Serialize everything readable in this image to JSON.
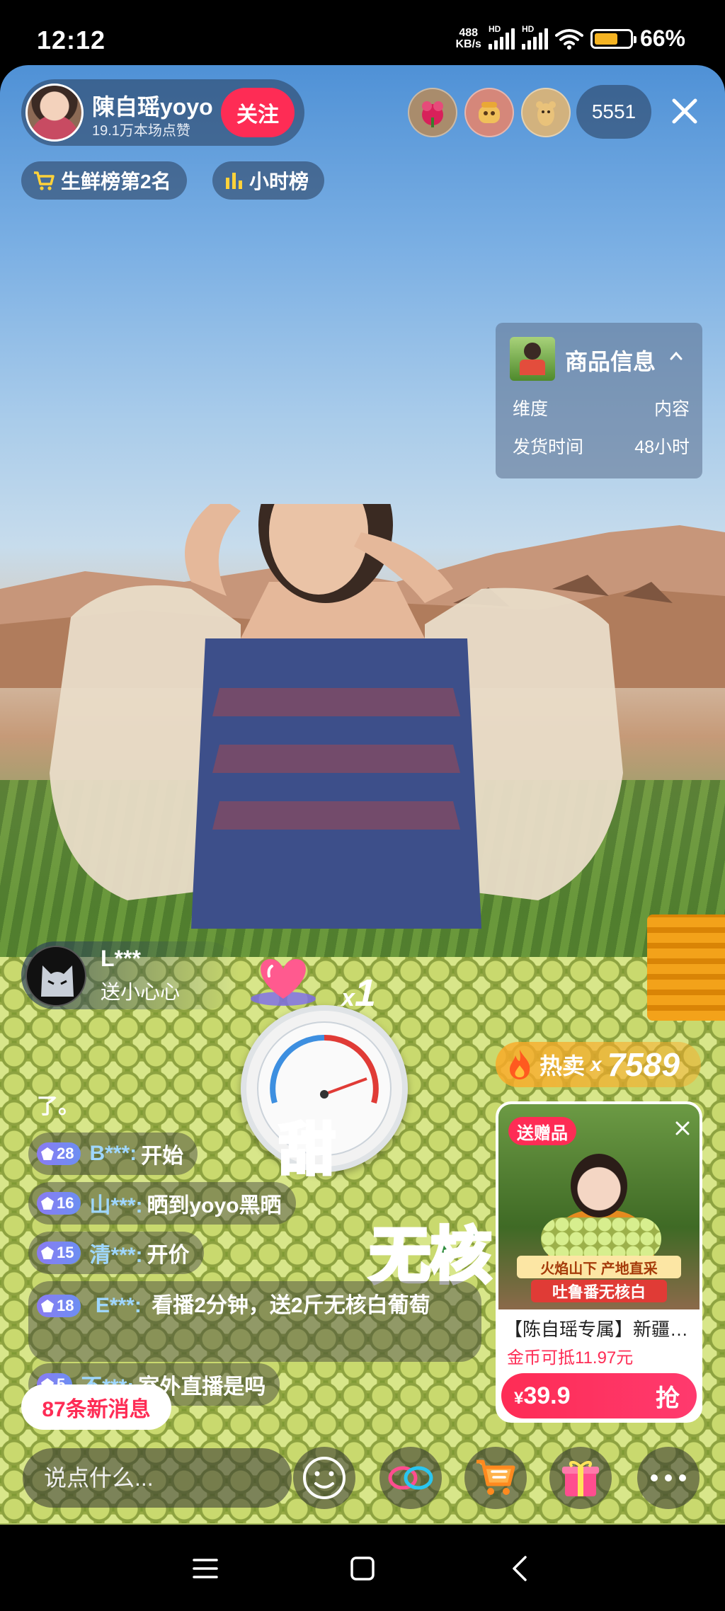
{
  "status_bar": {
    "time": "12:12",
    "net_speed_value": "488",
    "net_speed_unit": "KB/s",
    "sim1_label": "HD",
    "sim2_label": "HD",
    "battery_percent": "66%",
    "battery_level": 0.66,
    "battery_color": "#f4b322"
  },
  "host": {
    "name": "陳自瑶yoyo",
    "likes": "19.1万本场点赞",
    "follow_label": "关注"
  },
  "viewers": {
    "count": "5551",
    "avatar_icons": [
      "red-flower-avatar-icon",
      "bread-avatar-icon",
      "bear-avatar-icon"
    ]
  },
  "ranks": {
    "fresh_label": "生鲜榜第2名",
    "hourly_label": "小时榜"
  },
  "info_card": {
    "title": "商品信息",
    "rows": [
      {
        "label": "维度",
        "value": "内容"
      },
      {
        "label": "发货时间",
        "value": "48小时"
      }
    ]
  },
  "gift": {
    "user": "L***",
    "text": "送小心心",
    "count_prefix": "x",
    "count": "1"
  },
  "stickers": {
    "sweet": "甜",
    "seedless": "无核"
  },
  "hot_sale": {
    "label": "热卖",
    "x": "x",
    "count": "7589"
  },
  "comments": {
    "partial": "了。",
    "items": [
      {
        "level": "28",
        "user": "B***:",
        "text": "开始"
      },
      {
        "level": "16",
        "user": "山***:",
        "text": "晒到yoyo黑晒"
      },
      {
        "level": "15",
        "user": "清***:",
        "text": "开价"
      },
      {
        "level": "18",
        "user": "E***:",
        "text": "看播2分钟，送2斤无核白葡萄"
      },
      {
        "level": "5",
        "user": "不***:",
        "text": "室外直播是吗"
      }
    ],
    "new_messages": "87条新消息"
  },
  "product": {
    "gift_tag": "送赠品",
    "banner_top": "火焰山下 产地直采",
    "banner_bottom": "吐鲁番无核白",
    "title": "【陈自瑶专属】新疆吐鲁番无核白葡萄",
    "coupon": "金币可抵11.97元",
    "currency": "¥",
    "price": "39.9",
    "buy_label": "抢"
  },
  "input": {
    "placeholder": "说点什么..."
  },
  "colors": {
    "accent": "#fe2c55",
    "hot": "#f4a12a",
    "level_badge": "#7b86f2"
  }
}
